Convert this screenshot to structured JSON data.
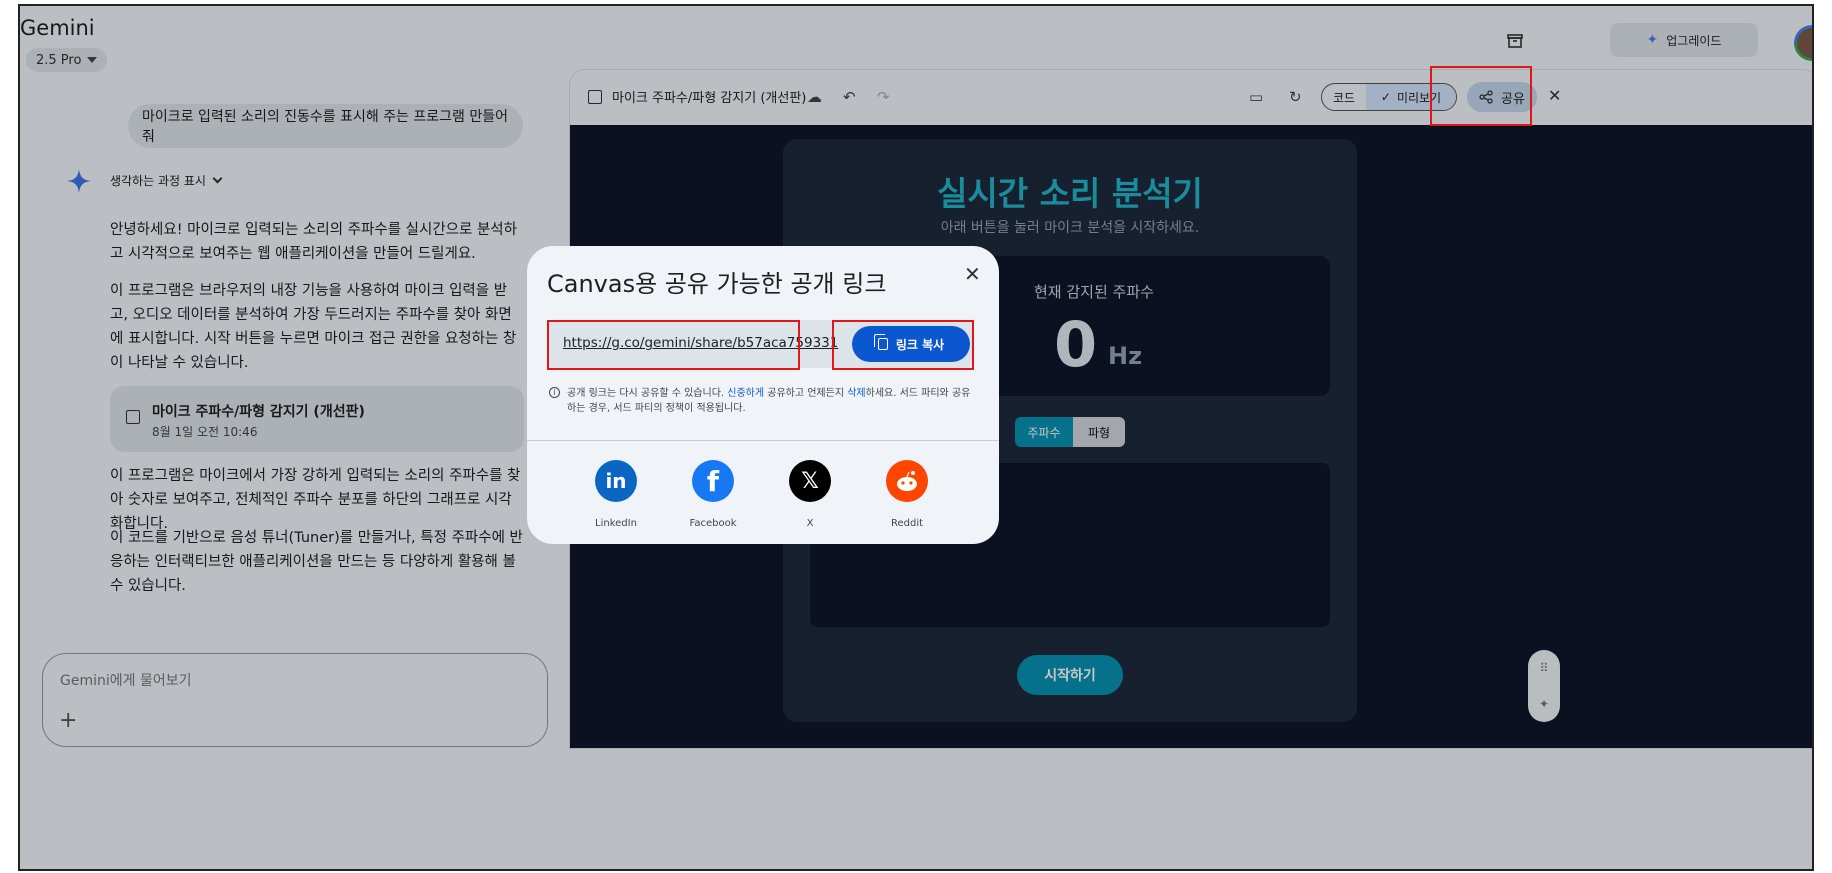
{
  "header": {
    "app_title": "Gemini",
    "model": "2.5 Pro",
    "upgrade_label": "업그레이드"
  },
  "chat": {
    "user_message": "마이크로 입력된 소리의 진동수를 표시해 주는 프로그램 만들어 줘",
    "thinking_label": "생각하는 과정 표시",
    "paragraph_1": "안녕하세요! 마이크로 입력되는 소리의 주파수를 실시간으로 분석하고 시각적으로 보여주는 웹 애플리케이션을 만들어 드릴게요.",
    "paragraph_2": "이 프로그램은 브라우저의 내장 기능을 사용하여 마이크 입력을 받고, 오디오 데이터를 분석하여 가장 두드러지는 주파수를 찾아 화면에 표시합니다. 시작 버튼을 누르면 마이크 접근 권한을 요청하는 창이 나타날 수 있습니다.",
    "canvas_card_title": "마이크 주파수/파형 감지기 (개선판)",
    "canvas_card_date": "8월 1일 오전 10:46",
    "paragraph_3": "이 프로그램은 마이크에서 가장 강하게 입력되는 소리의 주파수를 찾아 숫자로 보여주고, 전체적인 주파수 분포를 하단의 그래프로 시각화합니다.",
    "paragraph_4": "이 코드를 기반으로 음성 튜너(Tuner)를 만들거나, 특정 주파수에 반응하는 인터랙티브한 애플리케이션을 만드는 등 다양하게 활용해 볼 수 있습니다.",
    "input_placeholder": "Gemini에게 물어보기"
  },
  "canvas": {
    "title": "마이크 주파수/파형 감지기 (개선판)",
    "code_label": "코드",
    "preview_label": "미리보기",
    "share_label": "공유",
    "app_title": "실시간 소리 분석기",
    "app_subtitle": "아래 버튼을 눌러 마이크 분석을 시작하세요.",
    "freq_label": "현재 감지된 주파수",
    "freq_value": "0",
    "freq_unit": "Hz",
    "tab_freq": "주파수",
    "tab_wave": "파형",
    "start_label": "시작하기"
  },
  "dialog": {
    "title": "Canvas용 공유 가능한 공개 링크",
    "link": "https://g.co/gemini/share/b57aca759331",
    "copy_label": "링크 복사",
    "notice_a": "공개 링크는 다시 공유할 수 있습니다. ",
    "notice_link1": "신중하게",
    "notice_b": " 공유하고 언제든지 ",
    "notice_link2": "삭제",
    "notice_c": "하세요. 서드 파티와 공유하는 경우, 서드 파티의 정책이 적용됩니다.",
    "socials": [
      {
        "label": "LinkedIn",
        "icon": "linkedin-icon",
        "color": "#0a66c2"
      },
      {
        "label": "Facebook",
        "icon": "facebook-icon",
        "color": "#1877f2"
      },
      {
        "label": "X",
        "icon": "x-icon",
        "color": "#000000"
      },
      {
        "label": "Reddit",
        "icon": "reddit-icon",
        "color": "#ff4500"
      }
    ]
  },
  "colors": {
    "accent": "#0b57d0",
    "annotation": "#e01717",
    "app_accent": "#22b5c9"
  }
}
